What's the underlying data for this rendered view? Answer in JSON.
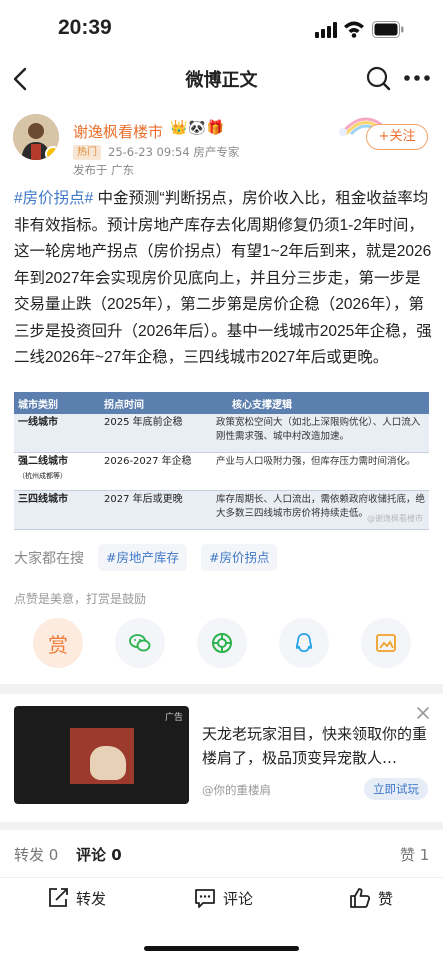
{
  "status_bar": {
    "time": "20:39"
  },
  "nav": {
    "title": "微博正文"
  },
  "author": {
    "name": "谢逸枫看楼市",
    "emojis": "👑🐼🎁",
    "hot_badge": "热门",
    "meta": "25-6-23 09:54  房产专家",
    "location": "发布于 广东",
    "follow_label": "+关注"
  },
  "post": {
    "tag": "#房价拐点#",
    "text": " 中金预测“判断拐点，房价收入比，租金收益率均非有效指标。预计房地产库存去化周期修复仍须1-2年时间，这一轮房地产拐点（房价拐点）有望1~2年后到来，就是2026年到2027年会实现房价见底向上，并且分三步走，第一步是交易量止跌（2025年），第二步第是房价企稳（2026年），第三步是投资回升（2026年后）。基中一线城市2025年企稳，强二线2026年~27年企稳，三四线城市2027年后或更晚。"
  },
  "table": {
    "headers": [
      "城市类别",
      "拐点时间",
      "核心支撑逻辑"
    ],
    "rows": [
      {
        "category": "一线城市",
        "sub": "",
        "time": "2025 年底前企稳",
        "logic": "政策宽松空间大（如北上深限购优化）、人口流入刚性需求强、城中村改造加速。"
      },
      {
        "category": "强二线城市",
        "sub": "（杭州成都等）",
        "time": "2026-2027 年企稳",
        "logic": "产业与人口吸附力强，但库存压力需时间消化。"
      },
      {
        "category": "三四线城市",
        "sub": "",
        "time": "2027 年后或更晚",
        "logic": "库存周期长、人口流出，需依赖政府收储托底，绝大多数三四线城市房价将持续走低。"
      }
    ],
    "watermark": "@谢逸枫看楼市"
  },
  "search": {
    "label": "大家都在搜",
    "chips": [
      "#房地产库存",
      "#房价拐点"
    ]
  },
  "reward_tip": "点赞是美意，打赏是鼓励",
  "share_icons": [
    "reward-icon",
    "wechat-icon",
    "moments-icon",
    "qq-icon",
    "save-image-icon"
  ],
  "reward_label": "赏",
  "ad": {
    "label": "广告",
    "text": "天龙老玩家泪目，快来领取你的重楼肩了，极品顶变异宠散人…",
    "source": "@你的重楼肩",
    "button": "立即试玩"
  },
  "stats": {
    "forward": "转发 0",
    "comment": "评论 0",
    "like": "赞 1"
  },
  "bottom_bar": {
    "forward": "转发",
    "comment": "评论",
    "like": "赞"
  },
  "colors": {
    "accent": "#ea6f2d",
    "link": "#3f78c8",
    "table_header": "#5b7fae"
  }
}
